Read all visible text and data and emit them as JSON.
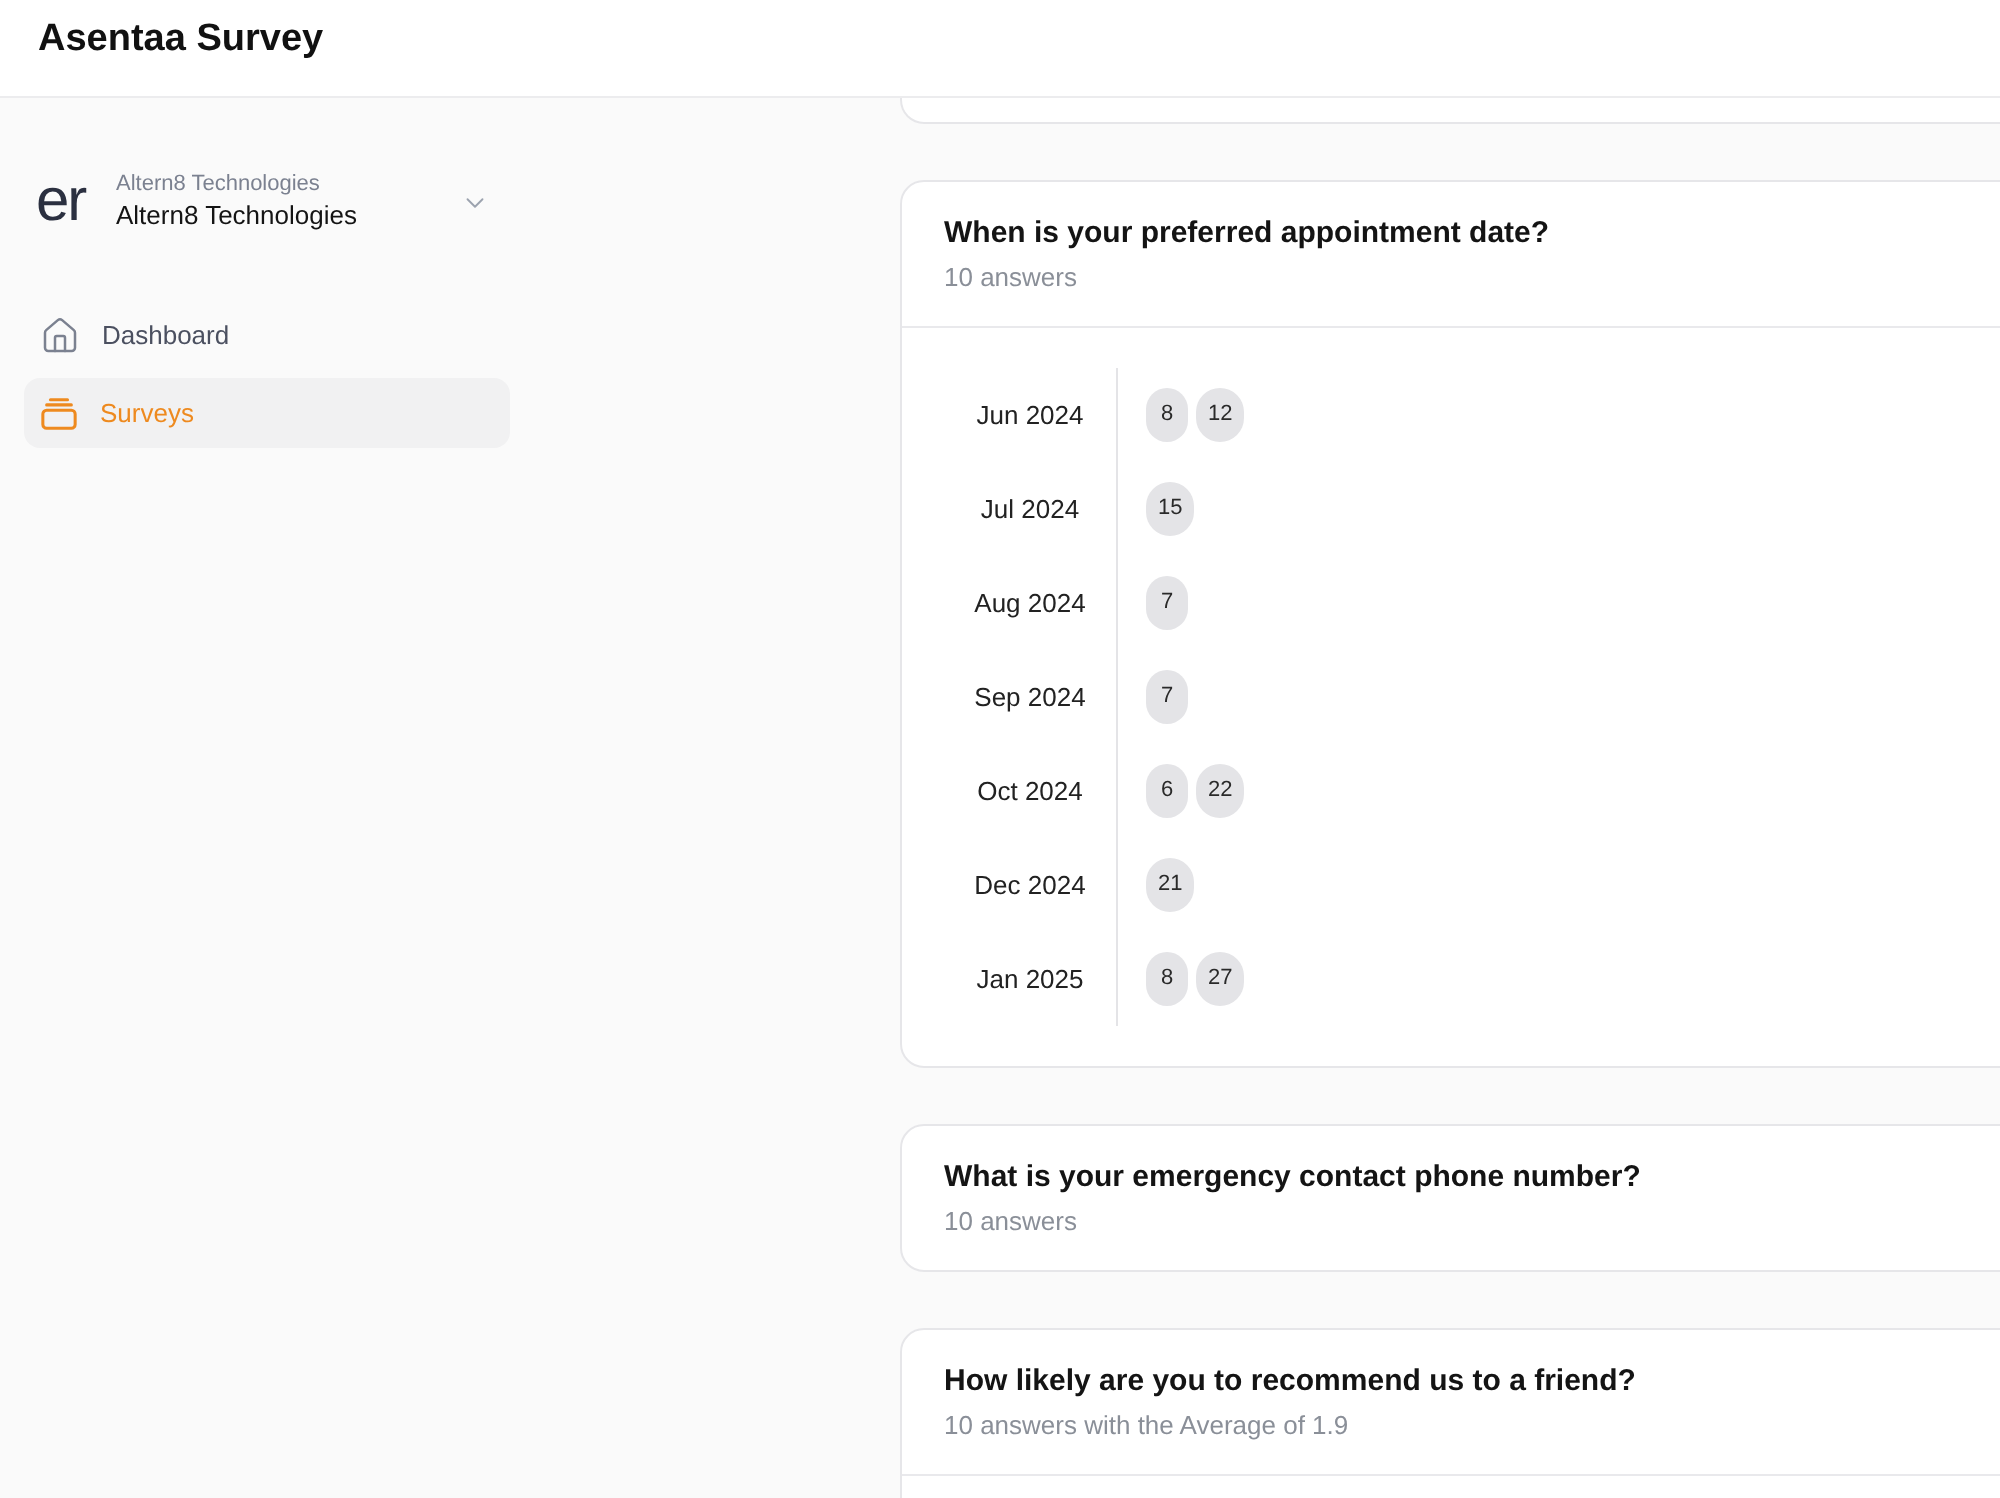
{
  "header": {
    "title": "Asentaa Survey"
  },
  "sidebar": {
    "org": {
      "logo_text": "er",
      "caption": "Altern8 Technologies",
      "name": "Altern8 Technologies"
    },
    "items": [
      {
        "label": "Dashboard",
        "selected": false
      },
      {
        "label": "Surveys",
        "selected": true
      }
    ]
  },
  "questions": [
    {
      "kind": "date",
      "title": "When is your preferred appointment date?",
      "summary": "10 answers",
      "dates": [
        {
          "month": "Jun 2024",
          "days": [
            "8",
            "12"
          ]
        },
        {
          "month": "Jul 2024",
          "days": [
            "15"
          ]
        },
        {
          "month": "Aug 2024",
          "days": [
            "7"
          ]
        },
        {
          "month": "Sep 2024",
          "days": [
            "7"
          ]
        },
        {
          "month": "Oct 2024",
          "days": [
            "6",
            "22"
          ]
        },
        {
          "month": "Dec 2024",
          "days": [
            "21"
          ]
        },
        {
          "month": "Jan 2025",
          "days": [
            "8",
            "27"
          ]
        }
      ]
    },
    {
      "kind": "text",
      "title": "What is your emergency contact phone number?",
      "summary": "10 answers"
    },
    {
      "kind": "rating",
      "title": "How likely are you to recommend us to a friend?",
      "summary": "10 answers with the Average of 1.9"
    }
  ]
}
